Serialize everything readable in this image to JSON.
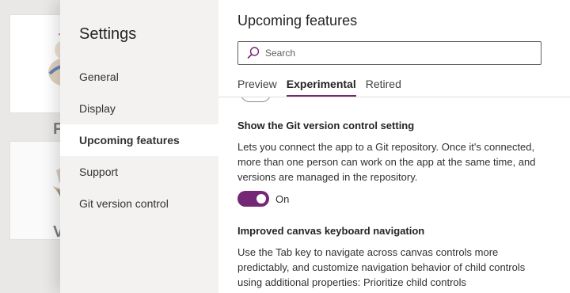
{
  "background_app": {
    "card1_letter": "P",
    "card2_letter": "Vo"
  },
  "settings": {
    "title": "Settings",
    "nav": [
      {
        "label": "General"
      },
      {
        "label": "Display"
      },
      {
        "label": "Upcoming features"
      },
      {
        "label": "Support"
      },
      {
        "label": "Git version control"
      }
    ],
    "active_nav_index": 2
  },
  "upcoming": {
    "title": "Upcoming features",
    "search_placeholder": "Search",
    "tabs": [
      {
        "label": "Preview"
      },
      {
        "label": "Experimental"
      },
      {
        "label": "Retired"
      }
    ],
    "active_tab": "Experimental",
    "features": [
      {
        "title": "Show the Git version control setting",
        "description": "Lets you connect the app to a Git repository. Once it's connected, more than one person can work on the app at the same time, and versions are managed in the repository.",
        "toggle_state": "On"
      },
      {
        "title": "Improved canvas keyboard navigation",
        "description": "Use the Tab key to navigate across canvas controls more predictably, and customize navigation behavior of child controls using additional properties: Prioritize child controls"
      }
    ]
  },
  "colors": {
    "accent": "#742774",
    "nav_bg": "#f3f2f1",
    "content_bg": "#ffffff"
  }
}
